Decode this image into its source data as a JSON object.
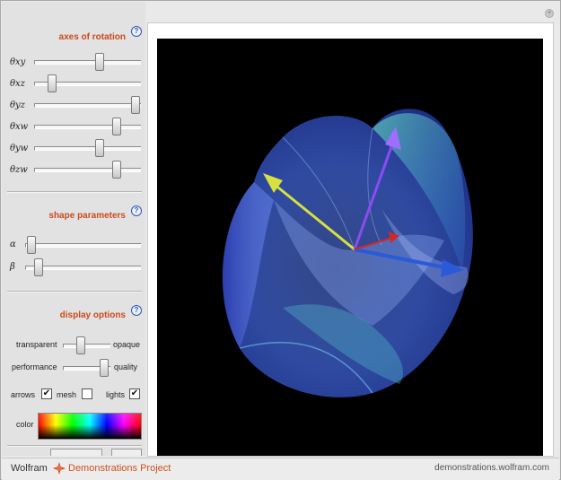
{
  "sections": {
    "axes_title": "axes of rotation",
    "shape_title": "shape parameters",
    "display_title": "display options",
    "help_glyph": "?"
  },
  "sliders_axes": [
    {
      "label": "θxy",
      "value": 0.62
    },
    {
      "label": "θxz",
      "value": 0.14
    },
    {
      "label": "θyz",
      "value": 0.99
    },
    {
      "label": "θxw",
      "value": 0.8
    },
    {
      "label": "θyw",
      "value": 0.62
    },
    {
      "label": "θzw",
      "value": 0.8
    }
  ],
  "sliders_shape": [
    {
      "label": "α",
      "value": 0.02
    },
    {
      "label": "β",
      "value": 0.08
    }
  ],
  "display": {
    "transparent_label": "transparent",
    "opaque_label": "opaque",
    "transparency_value": 0.35,
    "performance_label": "performance",
    "quality_label": "quality",
    "performance_value": 0.95,
    "arrows_label": "arrows",
    "arrows_checked": true,
    "mesh_label": "mesh",
    "mesh_checked": false,
    "lights_label": "lights",
    "lights_checked": true,
    "color_label": "color",
    "check_glyph": "✔"
  },
  "footer": {
    "brand_wolfram": "Wolfram",
    "brand_project": "Demonstrations Project",
    "url": "demonstrations.wolfram.com"
  },
  "corner_glyph": "+",
  "colors": {
    "section_title": "#cc4a1c",
    "surface_blue": "#3a5cc8",
    "surface_teal": "#3fa4a0",
    "arrow_yellow": "#d8e040",
    "arrow_purple": "#8a4cf0",
    "arrow_blue": "#2a5ad8",
    "arrow_red": "#d02828"
  }
}
